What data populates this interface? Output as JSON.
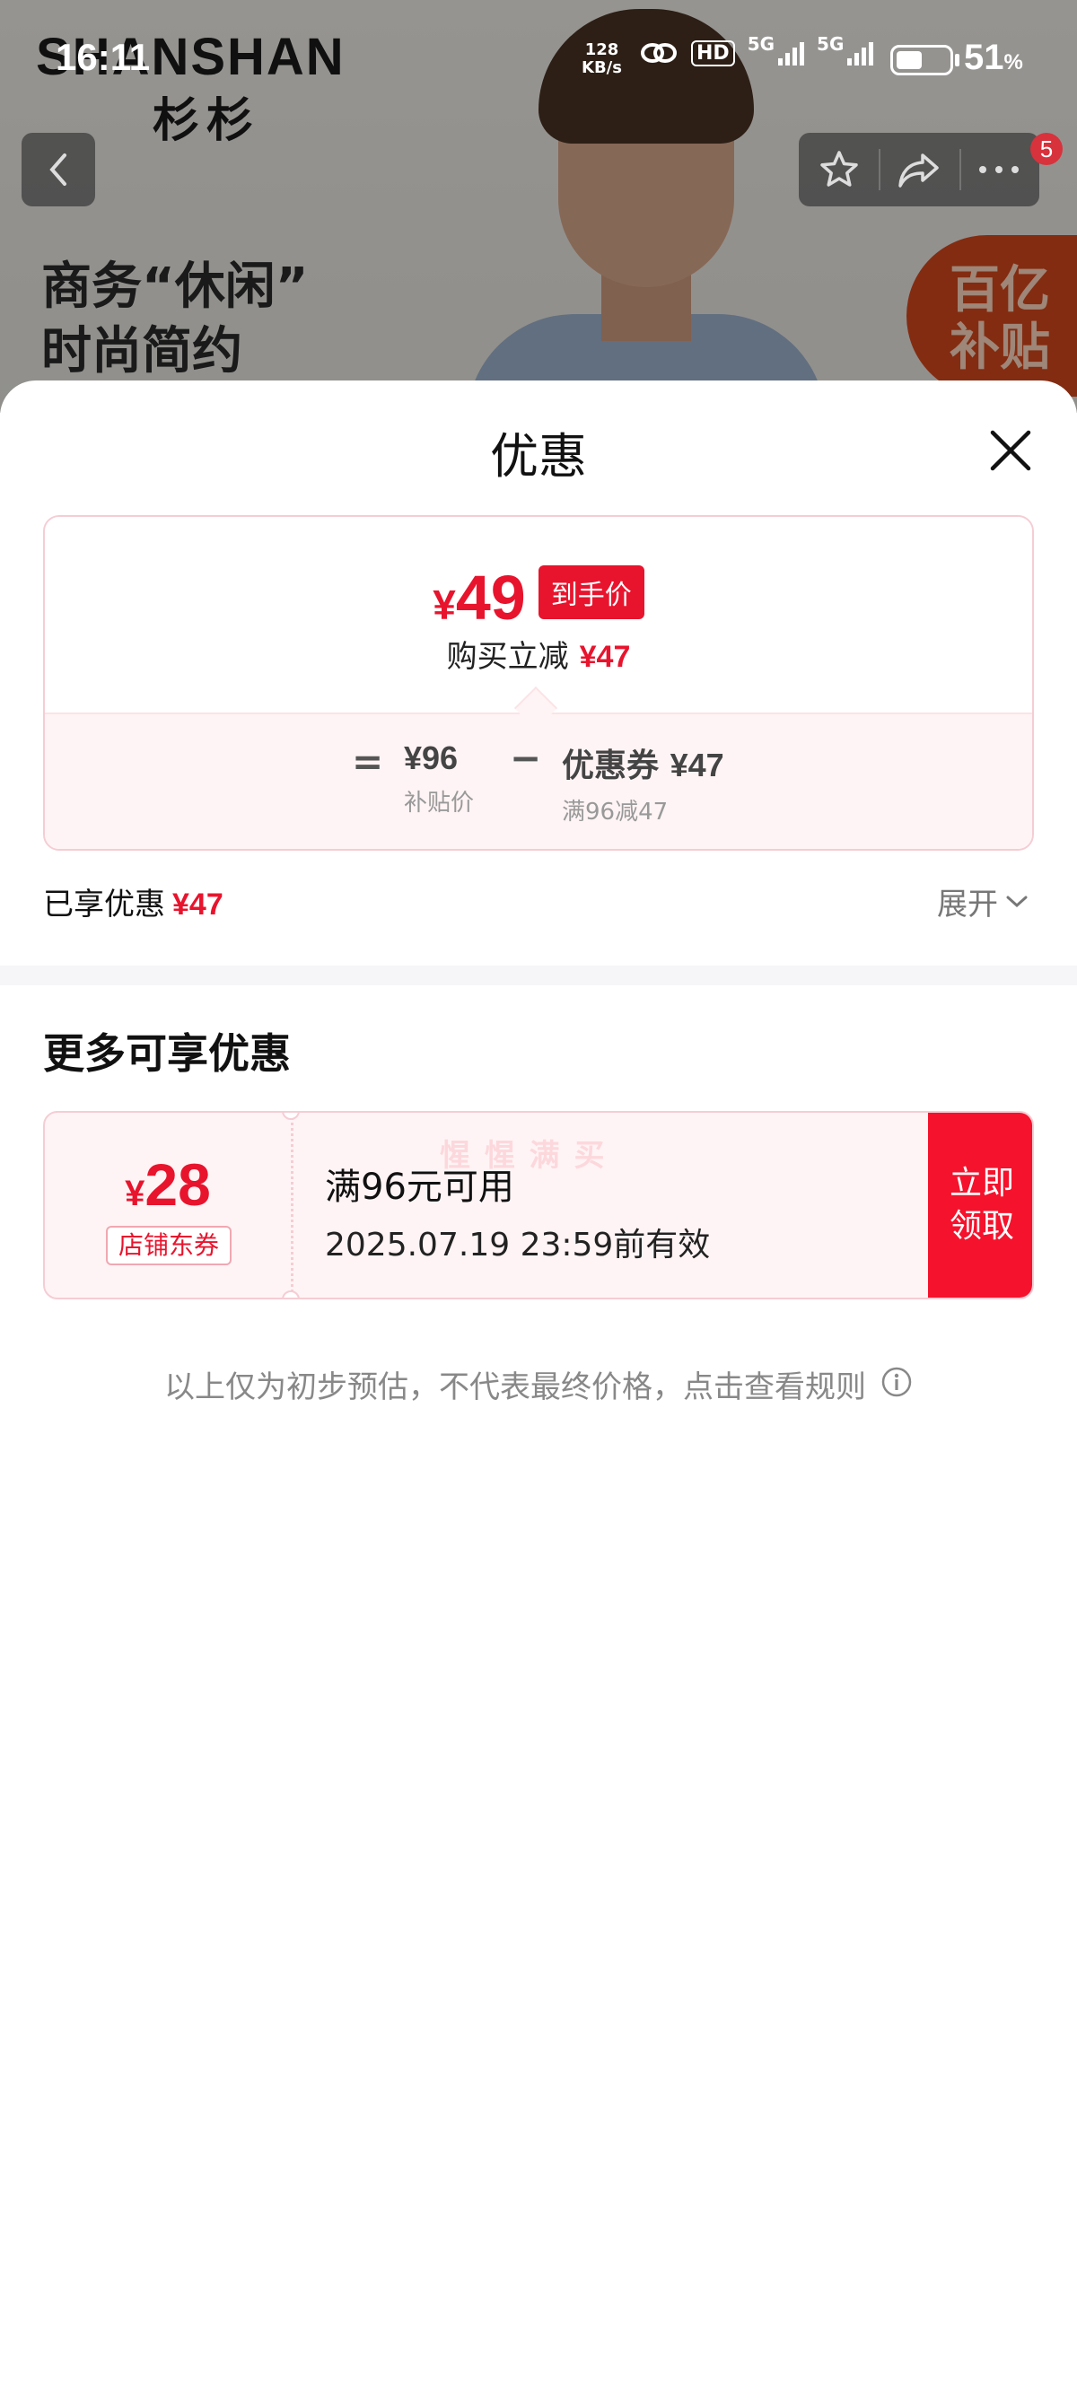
{
  "status_bar": {
    "time": "16:11",
    "network_speed_value": "128",
    "network_speed_unit": "KB/s",
    "hd_label": "HD",
    "signal1_label": "5G",
    "signal2_label": "5G",
    "battery_percent": "51",
    "battery_unit": "%",
    "battery_level": 0.51
  },
  "banner": {
    "brand_en": "SHANSHAN",
    "brand_cn": "杉杉",
    "slogan_line1": "商务“休闲”",
    "slogan_line2": "时尚简约",
    "subsidy_line1": "百亿",
    "subsidy_line2": "补贴"
  },
  "top_bar": {
    "badge_count": "5"
  },
  "sheet": {
    "title": "优惠",
    "price_summary": {
      "currency": "¥",
      "final_price": "49",
      "final_tag": "到手价",
      "reduce_label": "购买立减",
      "reduce_amount": "¥47",
      "equals_sign": "=",
      "base_price": "¥96",
      "base_label": "补贴价",
      "minus_sign": "−",
      "coupon_label": "优惠券",
      "coupon_amount": "¥47",
      "coupon_rule": "满96减47"
    },
    "enjoyed_label": "已享优惠",
    "enjoyed_amount": "¥47",
    "expand_label": "展开",
    "more_title": "更多可享优惠",
    "coupon": {
      "currency": "¥",
      "amount": "28",
      "type": "店铺东券",
      "condition": "满96元可用",
      "expiry": "2025.07.19 23:59前有效",
      "watermark": "惺 惺 满 买",
      "claim_line1": "立即",
      "claim_line2": "领取"
    },
    "footnote": "以上仅为初步预估，不代表最终价格，点击查看规则"
  },
  "colors": {
    "accent_red": "#e8142d",
    "claim_red": "#f5122c",
    "card_border": "#f5cdd4",
    "card_tint": "#fff4f5"
  }
}
